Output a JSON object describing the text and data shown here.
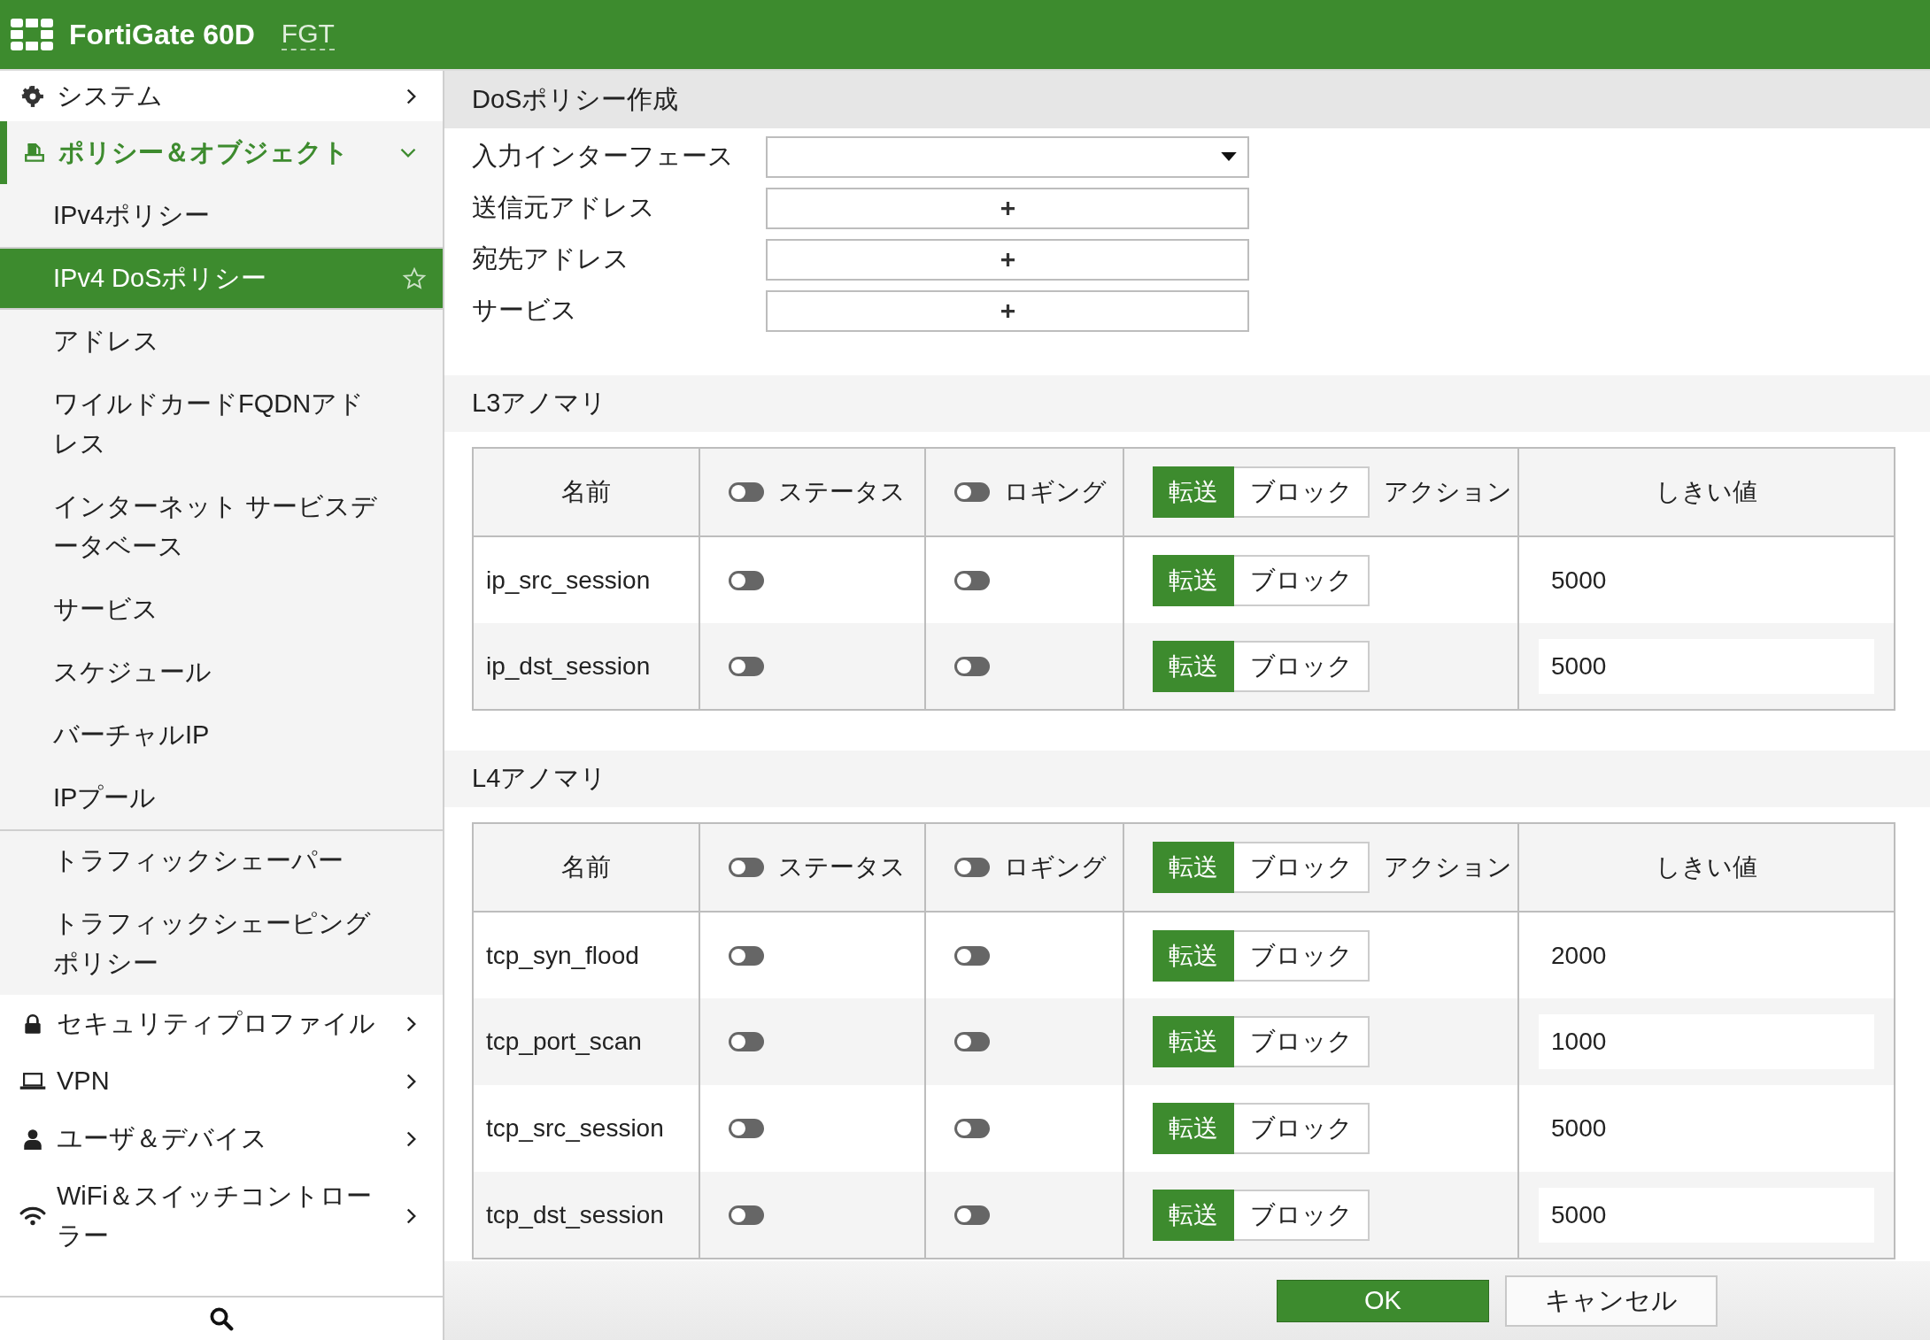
{
  "header": {
    "product": "FortiGate 60D",
    "hostname": "FGT"
  },
  "sidebar": {
    "items": [
      {
        "label": "システム",
        "expanded": false
      },
      {
        "label": "ポリシー＆オブジェクト",
        "expanded": true,
        "children": [
          {
            "label": "IPv4ポリシー",
            "selected": false,
            "divider_before": false
          },
          {
            "label": "IPv4 DoSポリシー",
            "selected": true,
            "divider_before": false
          },
          {
            "label": "アドレス",
            "selected": false,
            "divider_before": false
          },
          {
            "label": "ワイルドカードFQDNアドレス",
            "selected": false,
            "divider_before": false
          },
          {
            "label": "インターネット サービスデータベース",
            "selected": false,
            "divider_before": false
          },
          {
            "label": "サービス",
            "selected": false,
            "divider_before": false
          },
          {
            "label": "スケジュール",
            "selected": false,
            "divider_before": false
          },
          {
            "label": "バーチャルIP",
            "selected": false,
            "divider_before": false
          },
          {
            "label": "IPプール",
            "selected": false,
            "divider_before": false
          },
          {
            "label": "トラフィックシェーパー",
            "selected": false,
            "divider_before": true
          },
          {
            "label": "トラフィックシェーピングポリシー",
            "selected": false,
            "divider_before": false
          }
        ]
      },
      {
        "label": "セキュリティプロファイル",
        "expanded": false
      },
      {
        "label": "VPN",
        "expanded": false
      },
      {
        "label": "ユーザ＆デバイス",
        "expanded": false
      },
      {
        "label": "WiFi＆スイッチコントローラー",
        "expanded": false
      }
    ]
  },
  "form": {
    "title": "DoSポリシー作成",
    "fields": [
      {
        "label": "入力インターフェース",
        "kind": "dropdown"
      },
      {
        "label": "送信元アドレス",
        "kind": "add"
      },
      {
        "label": "宛先アドレス",
        "kind": "add"
      },
      {
        "label": "サービス",
        "kind": "add"
      }
    ]
  },
  "tables": [
    {
      "title": "L3アノマリ",
      "header": {
        "name": "名前",
        "status": {
          "label": "ステータス",
          "on": false
        },
        "logging": {
          "label": "ロギング",
          "on": false
        },
        "action": {
          "label": "アクション",
          "options": [
            {
              "label": "転送",
              "selected": true
            },
            {
              "label": "ブロック",
              "selected": false
            }
          ]
        },
        "threshold": "しきい値"
      },
      "rows": [
        {
          "name": "ip_src_session",
          "status_on": false,
          "logging_on": false,
          "action": [
            {
              "label": "転送",
              "selected": true
            },
            {
              "label": "ブロック",
              "selected": false
            }
          ],
          "threshold": "5000"
        },
        {
          "name": "ip_dst_session",
          "status_on": false,
          "logging_on": false,
          "action": [
            {
              "label": "転送",
              "selected": true
            },
            {
              "label": "ブロック",
              "selected": false
            }
          ],
          "threshold": "5000"
        }
      ]
    },
    {
      "title": "L4アノマリ",
      "header": {
        "name": "名前",
        "status": {
          "label": "ステータス",
          "on": false
        },
        "logging": {
          "label": "ロギング",
          "on": false
        },
        "action": {
          "label": "アクション",
          "options": [
            {
              "label": "転送",
              "selected": true
            },
            {
              "label": "ブロック",
              "selected": false
            }
          ]
        },
        "threshold": "しきい値"
      },
      "rows": [
        {
          "name": "tcp_syn_flood",
          "status_on": false,
          "logging_on": false,
          "action": [
            {
              "label": "転送",
              "selected": true
            },
            {
              "label": "ブロック",
              "selected": false
            }
          ],
          "threshold": "2000"
        },
        {
          "name": "tcp_port_scan",
          "status_on": false,
          "logging_on": false,
          "action": [
            {
              "label": "転送",
              "selected": true
            },
            {
              "label": "ブロック",
              "selected": false
            }
          ],
          "threshold": "1000"
        },
        {
          "name": "tcp_src_session",
          "status_on": false,
          "logging_on": false,
          "action": [
            {
              "label": "転送",
              "selected": true
            },
            {
              "label": "ブロック",
              "selected": false
            }
          ],
          "threshold": "5000"
        },
        {
          "name": "tcp_dst_session",
          "status_on": false,
          "logging_on": false,
          "action": [
            {
              "label": "転送",
              "selected": true
            },
            {
              "label": "ブロック",
              "selected": false
            }
          ],
          "threshold": "5000"
        }
      ]
    }
  ],
  "buttons": [
    {
      "label": "OK",
      "kind": "primary"
    },
    {
      "label": "キャンセル",
      "kind": "secondary"
    }
  ]
}
